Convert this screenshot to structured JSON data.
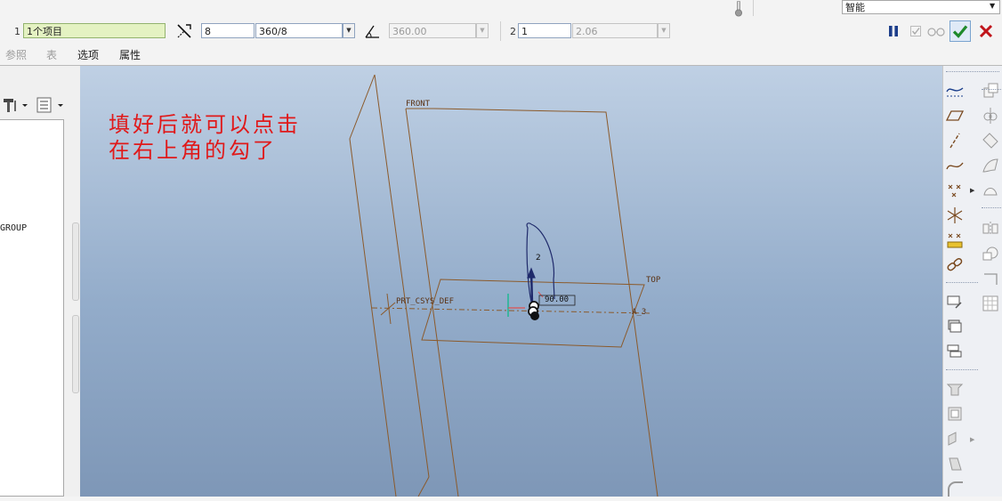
{
  "dashboard": {
    "references_count_label": "1",
    "references_value": "1个项目",
    "increment_count_value": "8",
    "increment_angle_value": "360/8",
    "extent_angle_value": "360.00",
    "direction2_label": "2",
    "direction2_count_value": "1",
    "direction2_spacing_value": "2.06",
    "filter_value": "智能",
    "tabs": [
      {
        "label": "参照",
        "enabled": false
      },
      {
        "label": "表",
        "enabled": false
      },
      {
        "label": "选项",
        "enabled": true
      },
      {
        "label": "属性",
        "enabled": true
      }
    ]
  },
  "model_tree": {
    "group_item": "GROUP"
  },
  "graphics": {
    "annotation": "填好后就可以点击\n在右上角的勾了",
    "datum_labels": {
      "front": "FRONT",
      "top": "TOP",
      "csys": "PRT_CSYS_DEF",
      "axis": "A_3"
    },
    "dimension_labels": {
      "count": "2",
      "angle": "90.00"
    }
  },
  "colors": {
    "datum_plane": "#8b5a2b",
    "annotation": "#e0191a",
    "accept": "#1f8a2b",
    "cancel": "#c0141a",
    "pattern_curve": "#1f2a6b"
  },
  "icons": [
    "direction-icon",
    "angle-icon",
    "pause-icon",
    "checkbox-icon",
    "glasses-icon",
    "accept-check-icon",
    "cancel-x-icon",
    "thermometer-icon",
    "filter-dropdown-icon",
    "hammer-settings-icon",
    "tree-list-icon"
  ]
}
